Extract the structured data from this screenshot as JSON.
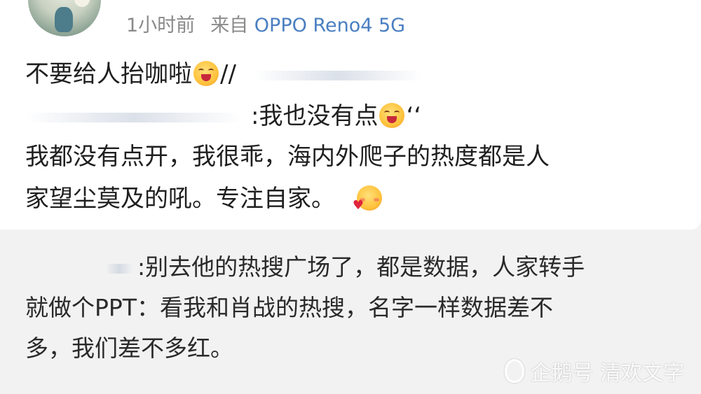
{
  "post": {
    "meta": {
      "time": "1小时前",
      "source_prefix": "来自",
      "device": "OPPO Reno4 5G"
    },
    "lines": [
      {
        "text": "不要给人抬咖啦",
        "after": "//"
      },
      {
        "text": ":我也没有点",
        "after": "‘‘"
      },
      {
        "text": "我都没有点开，我很乖，海内外爬子的热度都是人"
      },
      {
        "text": "家望尘莫及的吼。专注自家。"
      }
    ]
  },
  "reply": {
    "lines": [
      ":别去他的热搜广场了，都是数据，人家转手",
      "就做个PPT：看我和肖战的热搜，名字一样数据差不",
      "多，我们差不多红。"
    ]
  },
  "watermark": {
    "text": "企鹅号 清欢文字"
  },
  "icons": {
    "emoji_kiss": "kiss-emoji-icon",
    "emoji_shy": "shy-heart-emoji-icon",
    "watermark_logo": "penguin-icon"
  }
}
